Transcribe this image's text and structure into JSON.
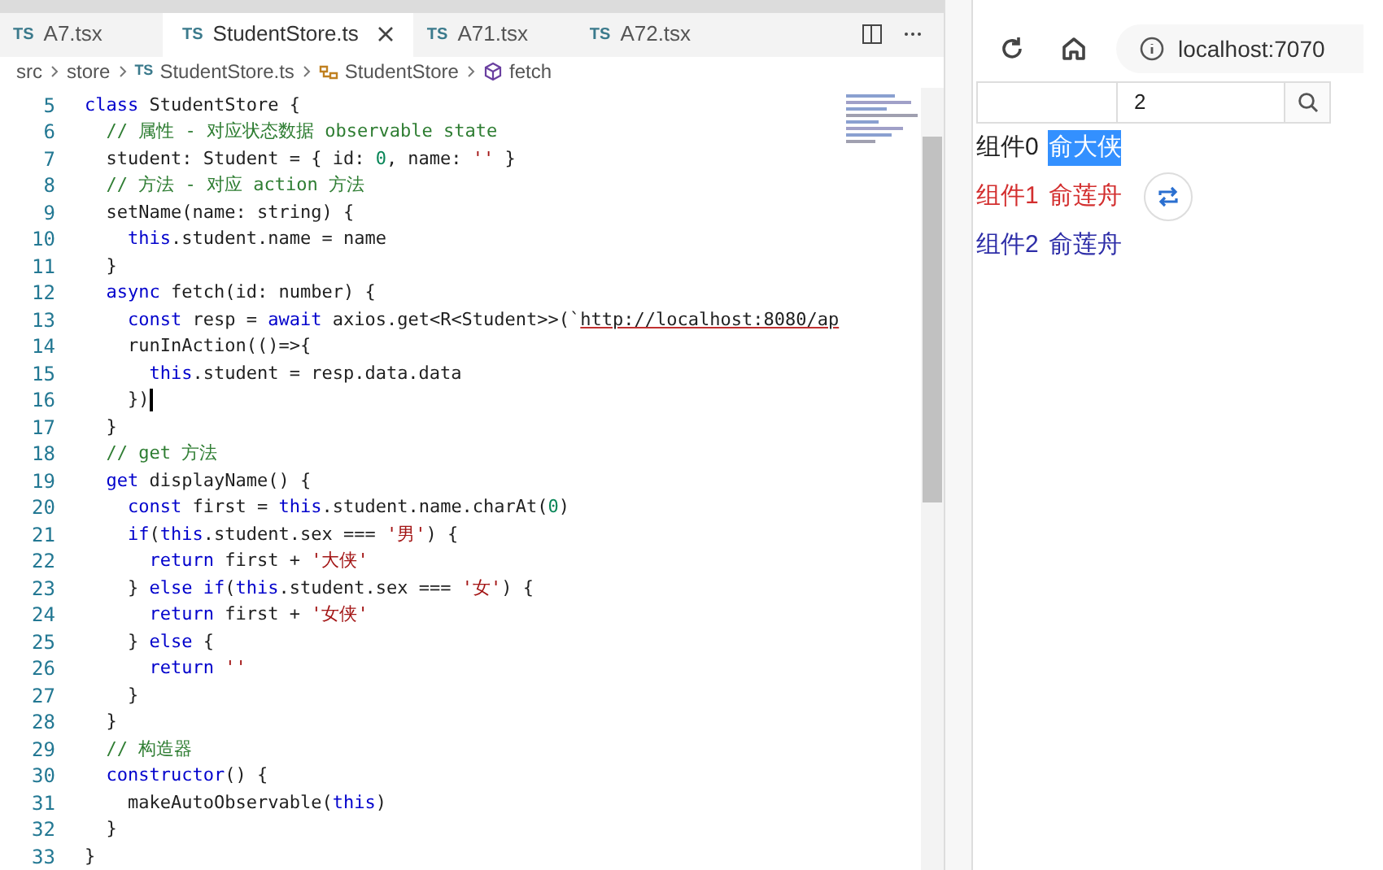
{
  "editor": {
    "tabs": [
      {
        "label": "A7.tsx",
        "badge": "TS",
        "selected": false,
        "closable": false
      },
      {
        "label": "StudentStore.ts",
        "badge": "TS",
        "selected": true,
        "closable": true
      },
      {
        "label": "A71.tsx",
        "badge": "TS",
        "selected": false,
        "closable": false
      },
      {
        "label": "A72.tsx",
        "badge": "TS",
        "selected": false,
        "closable": false
      }
    ],
    "breadcrumb": [
      {
        "kind": "folder",
        "label": "src"
      },
      {
        "kind": "folder",
        "label": "store"
      },
      {
        "kind": "file",
        "badge": "TS",
        "label": "StudentStore.ts"
      },
      {
        "kind": "class",
        "label": "StudentStore"
      },
      {
        "kind": "method",
        "label": "fetch"
      }
    ],
    "lines": [
      {
        "n": "5",
        "tokens": [
          {
            "kind": "kw",
            "text": "class"
          },
          {
            "kind": "plain",
            "text": " StudentStore {"
          }
        ]
      },
      {
        "n": "6",
        "tokens": [
          {
            "kind": "cmt",
            "text": "  // 属性 - 对应状态数据 observable state"
          }
        ]
      },
      {
        "n": "7",
        "tokens": [
          {
            "kind": "plain",
            "text": "  student: Student = { id: "
          },
          {
            "kind": "num",
            "text": "0"
          },
          {
            "kind": "plain",
            "text": ", name: "
          },
          {
            "kind": "str",
            "text": "''"
          },
          {
            "kind": "plain",
            "text": " }"
          }
        ]
      },
      {
        "n": "8",
        "tokens": [
          {
            "kind": "cmt",
            "text": "  // 方法 - 对应 action 方法"
          }
        ]
      },
      {
        "n": "9",
        "tokens": [
          {
            "kind": "plain",
            "text": "  setName(name: string) {"
          }
        ]
      },
      {
        "n": "10",
        "tokens": [
          {
            "kind": "kw",
            "text": "    this"
          },
          {
            "kind": "plain",
            "text": ".student.name = name"
          }
        ]
      },
      {
        "n": "11",
        "tokens": [
          {
            "kind": "plain",
            "text": "  }"
          }
        ]
      },
      {
        "n": "12",
        "tokens": [
          {
            "kind": "kw",
            "text": "  async"
          },
          {
            "kind": "plain",
            "text": " fetch(id: number) {"
          }
        ]
      },
      {
        "n": "13",
        "tokens": [
          {
            "kind": "kw",
            "text": "    const"
          },
          {
            "kind": "plain",
            "text": " resp = "
          },
          {
            "kind": "kw",
            "text": "await"
          },
          {
            "kind": "plain",
            "text": " axios.get<R<Student>>(`"
          },
          {
            "kind": "url",
            "text": "http://localhost:8080/ap"
          }
        ]
      },
      {
        "n": "14",
        "tokens": [
          {
            "kind": "plain",
            "text": "    runInAction(()=>{"
          }
        ]
      },
      {
        "n": "15",
        "tokens": [
          {
            "kind": "kw",
            "text": "      this"
          },
          {
            "kind": "plain",
            "text": ".student = resp.data.data"
          }
        ]
      },
      {
        "n": "16",
        "tokens": [
          {
            "kind": "plain",
            "text": "    })"
          }
        ],
        "cursor": true
      },
      {
        "n": "17",
        "tokens": [
          {
            "kind": "plain",
            "text": "  }"
          }
        ]
      },
      {
        "n": "18",
        "tokens": [
          {
            "kind": "cmt",
            "text": "  // get 方法"
          }
        ]
      },
      {
        "n": "19",
        "tokens": [
          {
            "kind": "kw",
            "text": "  get"
          },
          {
            "kind": "plain",
            "text": " displayName() {"
          }
        ]
      },
      {
        "n": "20",
        "tokens": [
          {
            "kind": "kw",
            "text": "    const"
          },
          {
            "kind": "plain",
            "text": " first = "
          },
          {
            "kind": "kw",
            "text": "this"
          },
          {
            "kind": "plain",
            "text": ".student.name.charAt("
          },
          {
            "kind": "num",
            "text": "0"
          },
          {
            "kind": "plain",
            "text": ")"
          }
        ]
      },
      {
        "n": "21",
        "tokens": [
          {
            "kind": "kw",
            "text": "    if"
          },
          {
            "kind": "plain",
            "text": "("
          },
          {
            "kind": "kw",
            "text": "this"
          },
          {
            "kind": "plain",
            "text": ".student.sex === "
          },
          {
            "kind": "str",
            "text": "'男'"
          },
          {
            "kind": "plain",
            "text": ") {"
          }
        ]
      },
      {
        "n": "22",
        "tokens": [
          {
            "kind": "kw",
            "text": "      return"
          },
          {
            "kind": "plain",
            "text": " first + "
          },
          {
            "kind": "str",
            "text": "'大侠'"
          }
        ]
      },
      {
        "n": "23",
        "tokens": [
          {
            "kind": "plain",
            "text": "    } "
          },
          {
            "kind": "kw",
            "text": "else if"
          },
          {
            "kind": "plain",
            "text": "("
          },
          {
            "kind": "kw",
            "text": "this"
          },
          {
            "kind": "plain",
            "text": ".student.sex === "
          },
          {
            "kind": "str",
            "text": "'女'"
          },
          {
            "kind": "plain",
            "text": ") {"
          }
        ]
      },
      {
        "n": "24",
        "tokens": [
          {
            "kind": "kw",
            "text": "      return"
          },
          {
            "kind": "plain",
            "text": " first + "
          },
          {
            "kind": "str",
            "text": "'女侠'"
          }
        ]
      },
      {
        "n": "25",
        "tokens": [
          {
            "kind": "plain",
            "text": "    } "
          },
          {
            "kind": "kw",
            "text": "else"
          },
          {
            "kind": "plain",
            "text": " {"
          }
        ]
      },
      {
        "n": "26",
        "tokens": [
          {
            "kind": "kw",
            "text": "      return"
          },
          {
            "kind": "str",
            "text": " ''"
          }
        ]
      },
      {
        "n": "27",
        "tokens": [
          {
            "kind": "plain",
            "text": "    }"
          }
        ]
      },
      {
        "n": "28",
        "tokens": [
          {
            "kind": "plain",
            "text": "  }"
          }
        ]
      },
      {
        "n": "29",
        "tokens": [
          {
            "kind": "cmt",
            "text": "  // 构造器"
          }
        ]
      },
      {
        "n": "30",
        "tokens": [
          {
            "kind": "kw",
            "text": "  constructor"
          },
          {
            "kind": "plain",
            "text": "() {"
          }
        ]
      },
      {
        "n": "31",
        "tokens": [
          {
            "kind": "plain",
            "text": "    makeAutoObservable("
          },
          {
            "kind": "kw",
            "text": "this"
          },
          {
            "kind": "plain",
            "text": ")"
          }
        ]
      },
      {
        "n": "32",
        "tokens": [
          {
            "kind": "plain",
            "text": "  }"
          }
        ]
      },
      {
        "n": "33",
        "tokens": [
          {
            "kind": "plain",
            "text": "}"
          }
        ]
      }
    ]
  },
  "browser": {
    "address": "localhost:7070",
    "search_value": "2",
    "rows": [
      {
        "label": "组件0",
        "name": "俞大侠",
        "color": "#222222",
        "highlighted": true,
        "swap_button": false
      },
      {
        "label": "组件1",
        "name": "俞莲舟",
        "color": "#d32f2f",
        "highlighted": false,
        "swap_button": true
      },
      {
        "label": "组件2",
        "name": "俞莲舟",
        "color": "#2e2ea8",
        "highlighted": false,
        "swap_button": false
      }
    ]
  }
}
